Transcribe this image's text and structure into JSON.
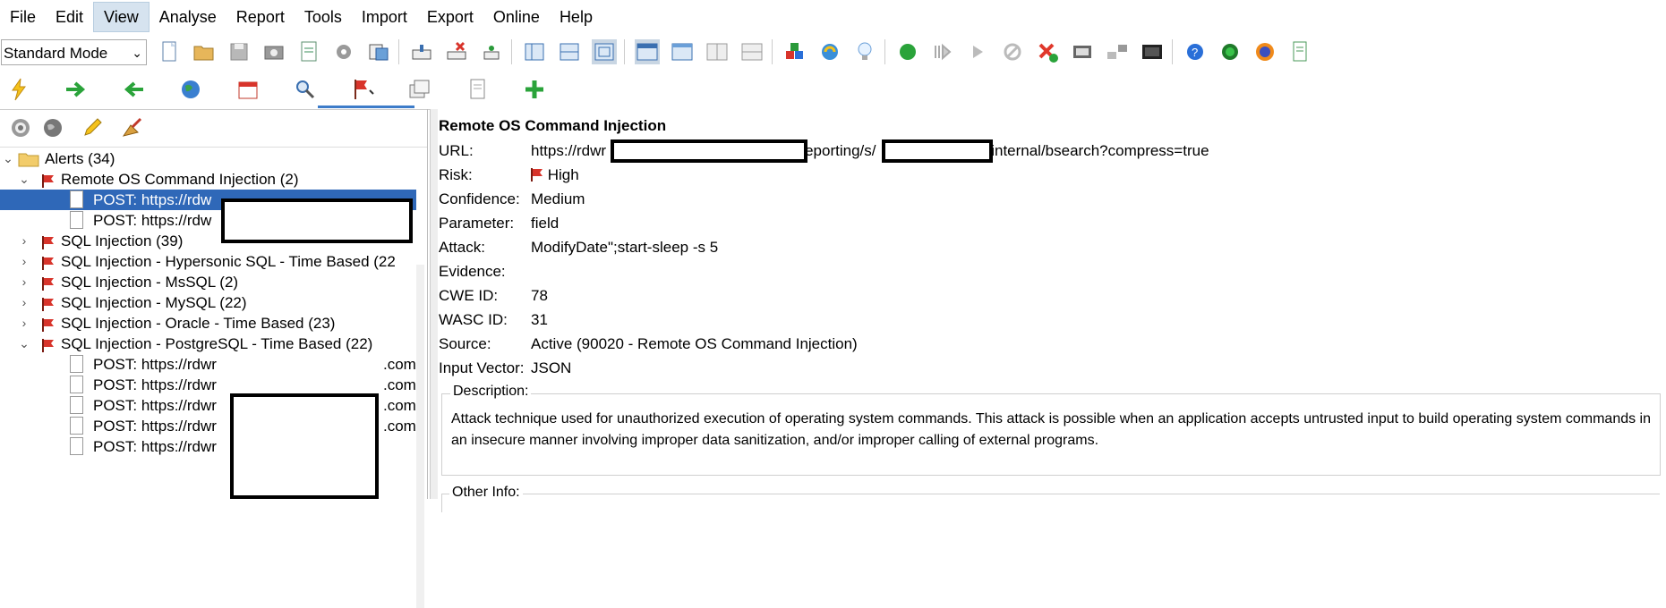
{
  "menu": [
    "File",
    "Edit",
    "View",
    "Analyse",
    "Report",
    "Tools",
    "Import",
    "Export",
    "Online",
    "Help"
  ],
  "active_menu": "View",
  "toolbar": {
    "mode_select": "Standard Mode",
    "icons": [
      "new-session-icon",
      "open-session-icon",
      "save-session-icon",
      "snapshot-icon",
      "session-properties-icon",
      "options-icon",
      "export-icon",
      "policy-icon",
      "break-icon",
      "scan-icon",
      "layout-panels-icon",
      "layout-tabs-icon",
      "layout-full-icon",
      "tab-left-icon",
      "tab-bottom-icon",
      "tab-right-icon",
      "tab-expand-icon",
      "add-ons-icon",
      "update-icon",
      "tip-icon",
      "start-icon",
      "step-icon",
      "continue-icon",
      "drop-icon",
      "remove-icon",
      "api-icon",
      "network-icon",
      "terminal-icon",
      "help-icon",
      "hud-icon",
      "firefox-icon",
      "notes-icon"
    ]
  },
  "toolbar2": {
    "icons": [
      "quick-start-icon",
      "request-icon",
      "response-icon",
      "sites-icon",
      "history-icon",
      "search-icon",
      "alerts-icon",
      "output-icon",
      "file-icon",
      "add-tab-icon"
    ]
  },
  "left_toolbar": {
    "icons": [
      "target-icon",
      "globe-icon",
      "edit-pencil-icon",
      "broom-icon"
    ]
  },
  "tree": {
    "root": "Alerts (34)",
    "rce_group": "Remote OS Command Injection (2)",
    "rce_items": [
      "POST: https://rdw",
      "POST: https://rdw"
    ],
    "groups": [
      "SQL Injection (39)",
      "SQL Injection - Hypersonic SQL - Time Based (22",
      "SQL Injection - MsSQL (2)",
      "SQL Injection - MySQL (22)",
      "SQL Injection - Oracle - Time Based (23)"
    ],
    "pg_group": "SQL Injection - PostgreSQL - Time Based (22)",
    "pg_items": [
      "POST: https://rdwr",
      "POST: https://rdwr",
      "POST: https://rdwr",
      "POST: https://rdwr",
      "POST: https://rdwr"
    ],
    "pg_suffix": ".com/"
  },
  "detail": {
    "title": "Remote OS Command Injection",
    "url_label": "URL:",
    "url_part1": "https://rdwr",
    "url_part2": "eporting/s/",
    "url_part3": "/internal/bsearch?compress=true",
    "risk_label": "Risk:",
    "risk": "High",
    "confidence_label": "Confidence:",
    "confidence": "Medium",
    "parameter_label": "Parameter:",
    "parameter": "field",
    "attack_label": "Attack:",
    "attack": "ModifyDate\";start-sleep -s 5",
    "evidence_label": "Evidence:",
    "evidence": "",
    "cwe_label": "CWE ID:",
    "cwe": "78",
    "wasc_label": "WASC ID:",
    "wasc": "31",
    "source_label": "Source:",
    "source": "Active (90020 - Remote OS Command Injection)",
    "vector_label": "Input Vector:",
    "vector": "JSON",
    "description_label": "Description:",
    "description": "Attack technique used for unauthorized execution of operating system commands. This attack is possible when an application accepts untrusted input to build operating system commands in an insecure manner involving improper data sanitization, and/or improper calling of external programs.",
    "other_label": "Other Info:"
  },
  "colors": {
    "selection": "#2f68b8",
    "flag_red": "#d8342b",
    "accent_blue": "#3d7cc9"
  }
}
